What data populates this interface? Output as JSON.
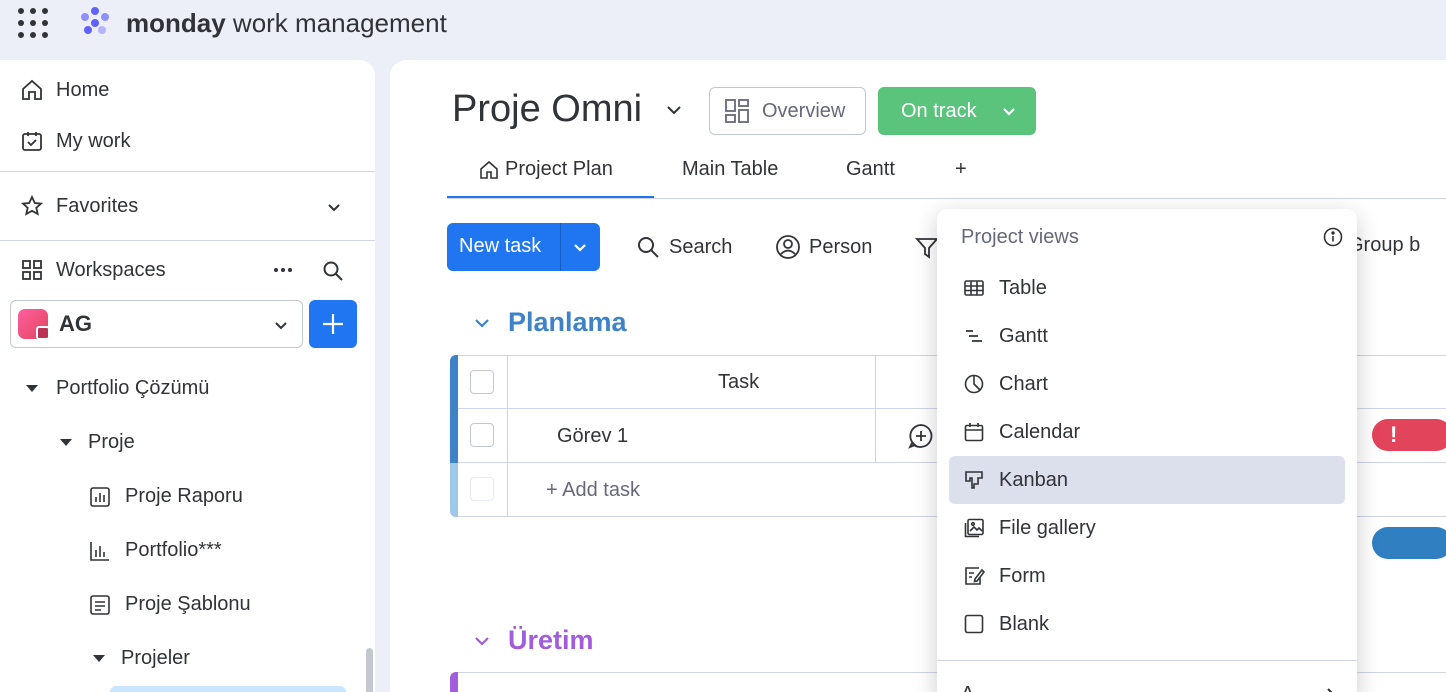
{
  "topbar": {
    "brand_bold": "monday",
    "brand_rest": " work management"
  },
  "sidebar": {
    "home": "Home",
    "my_work": "My work",
    "favorites": "Favorites",
    "workspaces": "Workspaces",
    "workspace_name": "AG",
    "tree": [
      {
        "label": "Portfolio Çözümü",
        "type": "folder"
      },
      {
        "label": "Proje",
        "type": "folder"
      },
      {
        "label": "Proje Raporu",
        "type": "dashboard"
      },
      {
        "label": "Portfolio***",
        "type": "dashboard"
      },
      {
        "label": "Proje Şablonu",
        "type": "board"
      },
      {
        "label": "Projeler",
        "type": "folder"
      }
    ]
  },
  "board": {
    "title": "Proje Omni",
    "overview_label": "Overview",
    "status_label": "On track",
    "status_color": "#5ac47d",
    "tabs": [
      "Project Plan",
      "Main Table",
      "Gantt",
      "+"
    ],
    "toolbar": {
      "new_task": "New task",
      "search": "Search",
      "person": "Person",
      "group_by": "Group b"
    },
    "groups": [
      {
        "title": "Planlama",
        "color": "#3e83c8"
      },
      {
        "title": "Üretim",
        "color": "#a25ddc"
      }
    ],
    "table": {
      "header_task": "Task",
      "rows": [
        "Görev 1"
      ],
      "add_task": "+ Add task",
      "status_mark": "!"
    }
  },
  "dropdown": {
    "title": "Project views",
    "items": [
      {
        "label": "Table",
        "icon": "table-icon"
      },
      {
        "label": "Gantt",
        "icon": "gantt-icon"
      },
      {
        "label": "Chart",
        "icon": "chart-icon"
      },
      {
        "label": "Calendar",
        "icon": "calendar-icon"
      },
      {
        "label": "Kanban",
        "icon": "kanban-icon"
      },
      {
        "label": "File gallery",
        "icon": "file-gallery-icon"
      },
      {
        "label": "Form",
        "icon": "form-icon"
      },
      {
        "label": "Blank",
        "icon": "blank-icon"
      }
    ],
    "more_label": "A..."
  }
}
